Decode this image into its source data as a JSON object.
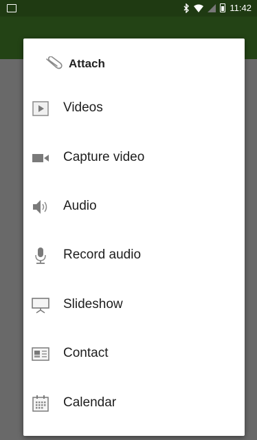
{
  "status_bar": {
    "time": "11:42"
  },
  "dialog": {
    "title": "Attach",
    "items": [
      {
        "label": "Videos",
        "icon": "video-file-icon"
      },
      {
        "label": "Capture video",
        "icon": "video-camera-icon"
      },
      {
        "label": "Audio",
        "icon": "speaker-icon"
      },
      {
        "label": "Record audio",
        "icon": "microphone-icon"
      },
      {
        "label": "Slideshow",
        "icon": "slideshow-icon"
      },
      {
        "label": "Contact",
        "icon": "contact-card-icon"
      },
      {
        "label": "Calendar",
        "icon": "calendar-icon"
      }
    ]
  },
  "colors": {
    "status_bar": "#1f3a12",
    "app_bar": "#2f5a1c",
    "dialog_bg": "#ffffff",
    "icon_gray": "#7a7a7a"
  }
}
